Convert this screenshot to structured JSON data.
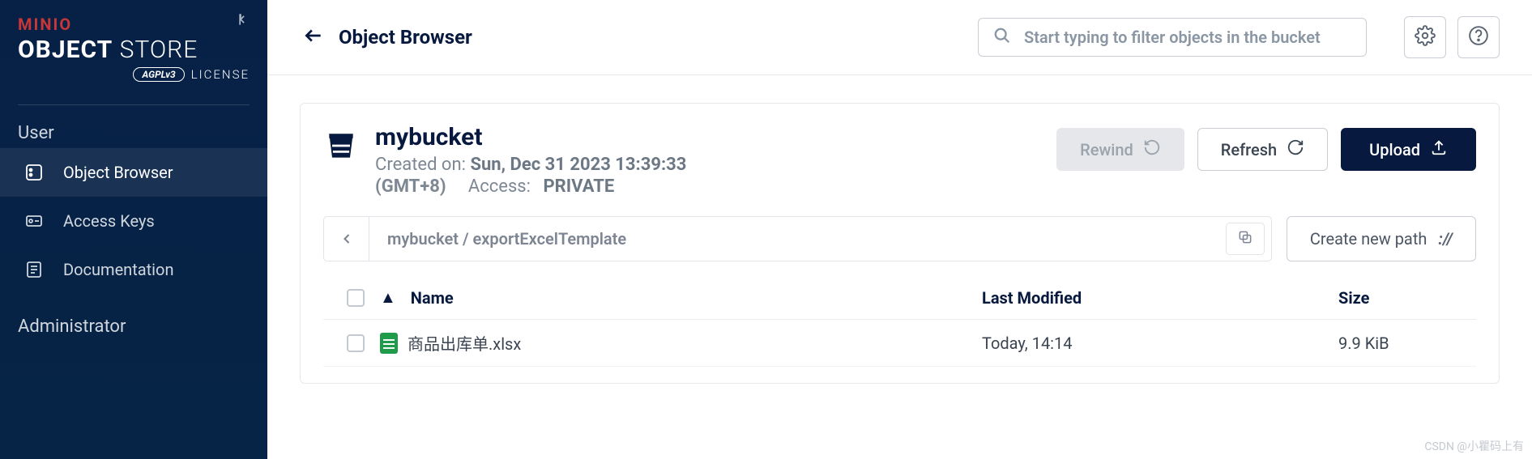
{
  "logo": {
    "brand": "MINIO",
    "title_bold": "OBJECT",
    "title_light": "STORE",
    "agpl": "AGPLv3",
    "license": "LICENSE"
  },
  "sidebar": {
    "sections": {
      "user": "User",
      "admin": "Administrator"
    },
    "items": [
      {
        "label": "Object Browser"
      },
      {
        "label": "Access Keys"
      },
      {
        "label": "Documentation"
      }
    ]
  },
  "header": {
    "title": "Object Browser",
    "search_placeholder": "Start typing to filter objects in the bucket"
  },
  "bucket": {
    "name": "mybucket",
    "created_label": "Created on:",
    "created_value": "Sun, Dec 31 2023 13:39:33",
    "tz": "(GMT+8)",
    "access_label": "Access:",
    "access_value": "PRIVATE"
  },
  "actions": {
    "rewind": "Rewind",
    "refresh": "Refresh",
    "upload": "Upload",
    "new_path": "Create new path"
  },
  "breadcrumb": {
    "parts": [
      "mybucket",
      "exportExcelTemplate"
    ],
    "display": "mybucket  /  exportExcelTemplate"
  },
  "table": {
    "columns": {
      "name": "Name",
      "modified": "Last Modified",
      "size": "Size"
    },
    "rows": [
      {
        "name": "商品出库单.xlsx",
        "modified": "Today, 14:14",
        "size": "9.9 KiB",
        "type": "xlsx"
      }
    ]
  },
  "watermark": "CSDN @小瞿码上有"
}
